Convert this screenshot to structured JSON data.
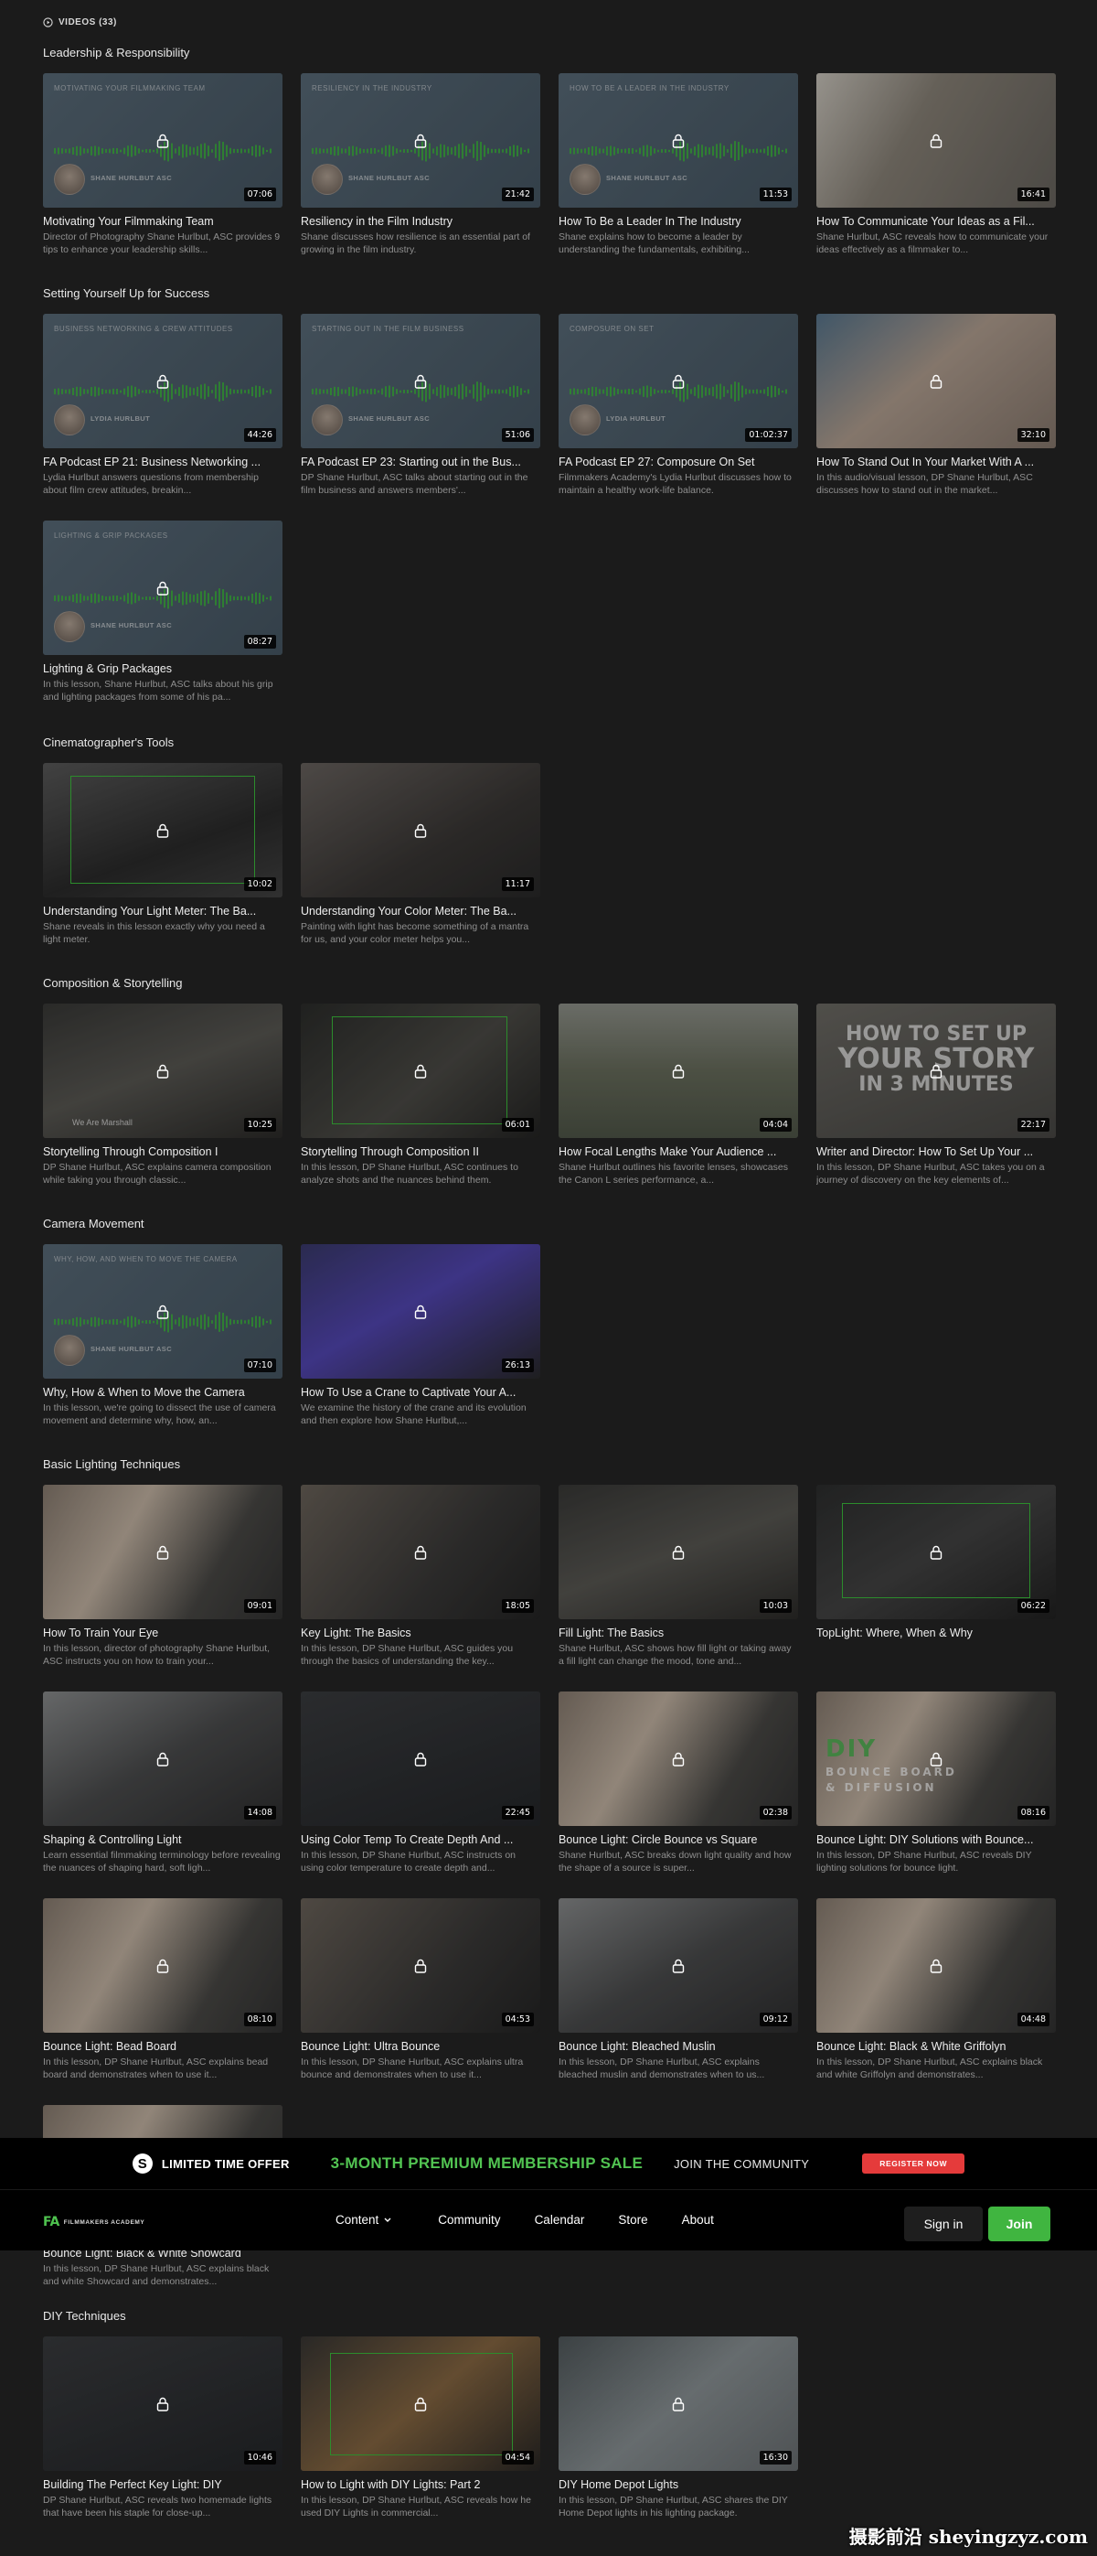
{
  "header": {
    "videos_label": "VIDEOS (33)"
  },
  "sections": [
    {
      "title": "Leadership & Responsibility",
      "cards": [
        {
          "title": "Motivating Your Filmmaking Team",
          "desc": "Director of Photography Shane Hurlbut, ASC provides 9 tips to enhance your leadership skills...",
          "duration": "07:06",
          "thumb": "podcast",
          "thumb_label": "MOTIVATING YOUR FILMMAKING TEAM",
          "speaker": "SHANE HURLBUT ASC"
        },
        {
          "title": "Resiliency in the Film Industry",
          "desc": "Shane discusses how resilience is an essential part of growing in the film industry.",
          "duration": "21:42",
          "thumb": "podcast",
          "thumb_label": "RESILIENCY IN THE INDUSTRY",
          "speaker": "SHANE HURLBUT ASC"
        },
        {
          "title": "How To Be a Leader In The Industry",
          "desc": "Shane explains how to become a leader by understanding the fundamentals, exhibiting...",
          "duration": "11:53",
          "thumb": "podcast",
          "thumb_label": "HOW TO BE A LEADER IN THE INDUSTRY",
          "speaker": "SHANE HURLBUT ASC"
        },
        {
          "title": "How To Communicate Your Ideas as a Fil...",
          "desc": "Shane Hurlbut, ASC reveals how to communicate your ideas effectively as a filmmaker to...",
          "duration": "16:41",
          "thumb": "people"
        }
      ]
    },
    {
      "title": "Setting Yourself Up for Success",
      "cards": [
        {
          "title": "FA Podcast EP 21: Business Networking ...",
          "desc": "Lydia Hurlbut answers questions from membership about film crew attitudes, breakin...",
          "duration": "44:26",
          "thumb": "podcast",
          "thumb_label": "BUSINESS NETWORKING & CREW ATTITUDES",
          "speaker": "LYDIA HURLBUT"
        },
        {
          "title": "FA Podcast EP 23: Starting out in the Bus...",
          "desc": "DP Shane Hurlbut, ASC talks about starting out in the film business and answers members'...",
          "duration": "51:06",
          "thumb": "podcast",
          "thumb_label": "STARTING OUT IN THE FILM BUSINESS",
          "speaker": "SHANE HURLBUT ASC"
        },
        {
          "title": "FA Podcast EP 27: Composure On Set",
          "desc": "Filmmakers Academy's Lydia Hurlbut discusses how to maintain a healthy work-life balance.",
          "duration": "01:02:37",
          "thumb": "podcast",
          "thumb_label": "COMPOSURE ON SET",
          "speaker": "LYDIA HURLBUT"
        },
        {
          "title": "How To Stand Out In Your Market With A ...",
          "desc": "In this audio/visual lesson, DP Shane Hurlbut, ASC discusses how to stand out in the market...",
          "duration": "32:10",
          "thumb": "kid"
        },
        {
          "title": "Lighting & Grip Packages",
          "desc": "In this lesson, Shane Hurlbut, ASC talks about his grip and lighting packages from some of his pa...",
          "duration": "08:27",
          "thumb": "podcast",
          "thumb_label": "LIGHTING & GRIP PACKAGES",
          "speaker": "SHANE HURLBUT ASC"
        }
      ]
    },
    {
      "title": "Cinematographer's Tools",
      "cards": [
        {
          "title": "Understanding Your Light Meter: The Ba...",
          "desc": "Shane reveals in this lesson exactly why you need a light meter.",
          "duration": "10:02",
          "thumb": "meter"
        },
        {
          "title": "Understanding Your Color Meter: The Ba...",
          "desc": "Painting with light has become something of a mantra for us, and your color meter helps you...",
          "duration": "11:17",
          "thumb": "colormeter"
        }
      ]
    },
    {
      "title": "Composition & Storytelling",
      "cards": [
        {
          "title": "Storytelling Through Composition I",
          "desc": "DP Shane Hurlbut, ASC explains camera composition while taking you through classic...",
          "duration": "10:25",
          "thumb": "darkroom",
          "watermark": "We Are Marshall"
        },
        {
          "title": "Storytelling Through Composition II",
          "desc": "In this lesson, DP Shane Hurlbut, ASC continues to analyze shots and the nuances behind them.",
          "duration": "06:01",
          "thumb": "set"
        },
        {
          "title": "How Focal Lengths Make Your Audience ...",
          "desc": "Shane Hurlbut outlines his favorite lenses, showcases the Canon L series performance, a...",
          "duration": "04:04",
          "thumb": "park"
        },
        {
          "title": "Writer and Director: How To Set Up Your ...",
          "desc": "In this lesson, DP Shane Hurlbut, ASC takes you on a journey of discovery on the key elements of...",
          "duration": "22:17",
          "thumb": "story",
          "big_text": [
            "HOW TO SET UP",
            "YOUR STORY",
            "IN 3 MINUTES"
          ]
        }
      ]
    },
    {
      "title": "Camera Movement",
      "cards": [
        {
          "title": "Why, How & When to Move the Camera",
          "desc": "In this lesson, we're going to dissect the use of camera movement and determine why, how, an...",
          "duration": "07:10",
          "thumb": "podcast",
          "thumb_label": "WHY, HOW, AND WHEN TO MOVE THE CAMERA",
          "speaker": "SHANE HURLBUT ASC"
        },
        {
          "title": "How To Use a Crane to Captivate Your A...",
          "desc": "We examine the history of the crane and its evolution and then explore how Shane Hurlbut,...",
          "duration": "26:13",
          "thumb": "crane"
        }
      ]
    },
    {
      "title": "Basic Lighting Techniques",
      "cards": [
        {
          "title": "How To Train Your Eye",
          "desc": "In this lesson, director of photography Shane Hurlbut, ASC instructs you on how to train your...",
          "duration": "09:01",
          "thumb": "blonde"
        },
        {
          "title": "Key Light: The Basics",
          "desc": "In this lesson, DP Shane Hurlbut, ASC guides you through the basics of understanding the key...",
          "duration": "18:05",
          "thumb": "man"
        },
        {
          "title": "Fill Light: The Basics",
          "desc": "Shane Hurlbut, ASC shows how fill light or taking away a fill light can change the mood, tone and...",
          "duration": "10:03",
          "thumb": "darkroom"
        },
        {
          "title": "TopLight: Where, When & Why",
          "desc": "",
          "duration": "06:22",
          "thumb": "dark2"
        },
        {
          "title": "Shaping & Controlling Light",
          "desc": "Learn essential filmmaking terminology before revealing the nuances of shaping hard, soft ligh...",
          "duration": "14:08",
          "thumb": "studio"
        },
        {
          "title": "Using Color Temp To Create Depth And ...",
          "desc": "In this lesson, DP Shane Hurlbut, ASC instructs on using color temperature to create depth and...",
          "duration": "22:45",
          "thumb": "night"
        },
        {
          "title": "Bounce Light: Circle Bounce vs Square",
          "desc": "Shane Hurlbut, ASC breaks down light quality and how the shape of a source is super...",
          "duration": "02:38",
          "thumb": "blonde"
        },
        {
          "title": "Bounce Light: DIY Solutions with Bounce...",
          "desc": "In this lesson, DP Shane Hurlbut, ASC reveals DIY lighting solutions for bounce light.",
          "duration": "08:16",
          "thumb": "blonde",
          "diy": [
            "DIY",
            "BOUNCE BOARD",
            "& DIFFUSION"
          ]
        },
        {
          "title": "Bounce Light: Bead Board",
          "desc": "In this lesson, DP Shane Hurlbut, ASC explains bead board and demonstrates when to use it...",
          "duration": "08:10",
          "thumb": "blonde"
        },
        {
          "title": "Bounce Light: Ultra Bounce",
          "desc": "In this lesson, DP Shane Hurlbut, ASC explains ultra bounce and demonstrates when to use it...",
          "duration": "04:53",
          "thumb": "man"
        },
        {
          "title": "Bounce Light: Bleached Muslin",
          "desc": "In this lesson, DP Shane Hurlbut, ASC explains bleached muslin and demonstrates when to us...",
          "duration": "09:12",
          "thumb": "studio"
        },
        {
          "title": "Bounce Light: Black & White Griffolyn",
          "desc": "In this lesson, DP Shane Hurlbut, ASC explains black and white Griffolyn and demonstrates...",
          "duration": "04:48",
          "thumb": "blonde"
        },
        {
          "title": "Bounce Light: Black & White Showcard",
          "desc": "In this lesson, DP Shane Hurlbut, ASC explains black and white Showcard and demonstrates...",
          "duration": "",
          "thumb": "blonde"
        }
      ]
    },
    {
      "title": "DIY Techniques",
      "cards": [
        {
          "title": "Building The Perfect Key Light: DIY",
          "desc": "DP Shane Hurlbut, ASC reveals two homemade lights that have been his staple for close-up...",
          "duration": "10:46",
          "thumb": "night"
        },
        {
          "title": "How to Light with DIY Lights: Part 2",
          "desc": "In this lesson, DP Shane Hurlbut, ASC reveals how he used DIY Lights in commercial...",
          "duration": "04:54",
          "thumb": "warm"
        },
        {
          "title": "DIY Home Depot Lights",
          "desc": "In this lesson, DP Shane Hurlbut, ASC shares the DIY Home Depot lights in his lighting package.",
          "duration": "16:30",
          "thumb": "diy"
        }
      ]
    }
  ],
  "promo": {
    "badge_icon": "S",
    "badge_label": "LIMITED TIME OFFER",
    "sale_label": "3-MONTH PREMIUM MEMBERSHIP SALE",
    "join_label": "JOIN THE COMMUNITY",
    "register_label": "REGISTER NOW",
    "accent": "#52c452",
    "register_color": "#e53b3b"
  },
  "nav": {
    "logo_mark": "FA",
    "logo_text": "FILMMAKERS ACADEMY",
    "links": [
      "Content",
      "Community",
      "Calendar",
      "Store",
      "About"
    ],
    "signin_label": "Sign in",
    "join_label": "Join",
    "join_color": "#40b540"
  },
  "watermark": "摄影前沿 sheyingzyz.com"
}
